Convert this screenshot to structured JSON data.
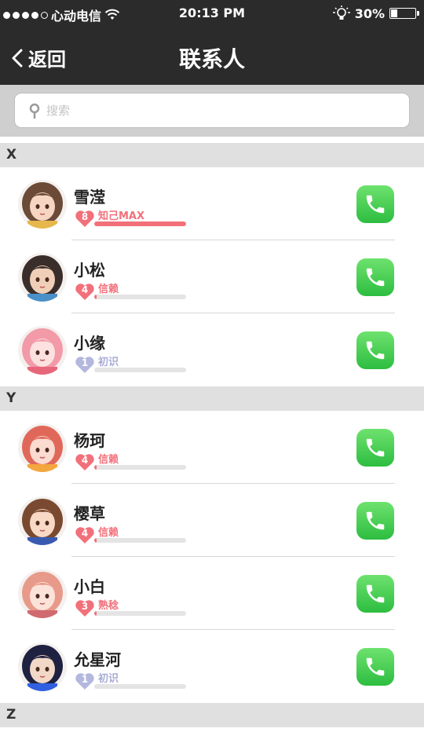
{
  "status_bar": {
    "carrier": "心动电信",
    "time": "20:13 PM",
    "battery": "30%",
    "battery_level": 0.3
  },
  "nav": {
    "back_label": "返回",
    "title": "联系人"
  },
  "search": {
    "placeholder": "搜索"
  },
  "sections": [
    {
      "letter": "X",
      "contacts": [
        {
          "name": "雪滢",
          "level": "8",
          "status": "知己MAX",
          "progress": 1.0,
          "heart_color": "#f2707a",
          "text_color": "#f2707a",
          "avatar_colors": [
            "#6b4a38",
            "#f6d6c2",
            "#e6b84c"
          ]
        },
        {
          "name": "小松",
          "level": "4",
          "status": "信赖",
          "progress": 0.02,
          "heart_color": "#f2707a",
          "text_color": "#f2707a",
          "avatar_colors": [
            "#3a2e2a",
            "#f0cfb8",
            "#4a90c8"
          ]
        },
        {
          "name": "小缘",
          "level": "1",
          "status": "初识",
          "progress": 0.0,
          "heart_color": "#b4b8de",
          "text_color": "#a8acd4",
          "avatar_colors": [
            "#f29aa8",
            "#fbe1df",
            "#e8667a"
          ]
        }
      ]
    },
    {
      "letter": "Y",
      "contacts": [
        {
          "name": "杨珂",
          "level": "4",
          "status": "信赖",
          "progress": 0.02,
          "heart_color": "#f2707a",
          "text_color": "#f2707a",
          "avatar_colors": [
            "#e0685a",
            "#fbdad0",
            "#f4a640"
          ]
        },
        {
          "name": "樱草",
          "level": "4",
          "status": "信赖",
          "progress": 0.02,
          "heart_color": "#f2707a",
          "text_color": "#f2707a",
          "avatar_colors": [
            "#7a4a30",
            "#f8d9c6",
            "#3a5ab0"
          ]
        },
        {
          "name": "小白",
          "level": "3",
          "status": "熟稔",
          "progress": 0.02,
          "heart_color": "#f2707a",
          "text_color": "#f2707a",
          "avatar_colors": [
            "#e89a8a",
            "#fbe3d9",
            "#d06a70"
          ]
        },
        {
          "name": "允星河",
          "level": "1",
          "status": "初识",
          "progress": 0.0,
          "heart_color": "#b4b8de",
          "text_color": "#a8acd4",
          "avatar_colors": [
            "#1e2140",
            "#f2d8c6",
            "#3060e0"
          ]
        }
      ]
    },
    {
      "letter": "Z",
      "contacts": []
    }
  ]
}
